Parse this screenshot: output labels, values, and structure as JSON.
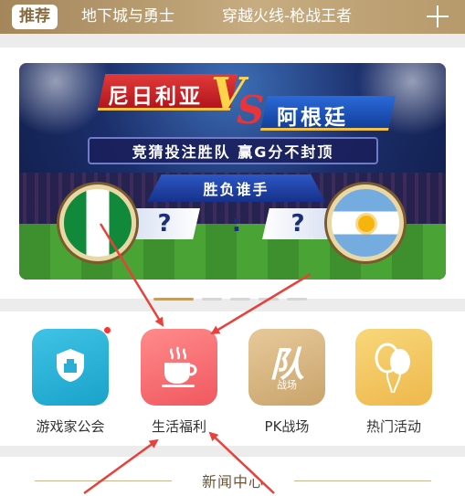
{
  "tabs": [
    {
      "label": "推荐",
      "active": true
    },
    {
      "label": "地下城与勇士",
      "active": false
    },
    {
      "label": "穿越火线-枪战王者",
      "active": false
    }
  ],
  "top_bar": {
    "add_icon": "plus-icon",
    "color": "#b79a6c"
  },
  "banner": {
    "team_left": "尼日利亚",
    "vs_v": "V",
    "vs_s": "S",
    "team_right": "阿根廷",
    "slogan": "竞猜投注胜队  赢G分不封顶",
    "question_title": "胜负谁手",
    "left_answer": "?",
    "separator": ":",
    "right_answer": "?",
    "flags": [
      "nigeria-flag",
      "argentina-flag"
    ],
    "carousel": {
      "pages": 5,
      "active": 1
    }
  },
  "apps": [
    {
      "label": "游戏家公会",
      "icon": "shield-icon",
      "color": "#29b3dc",
      "has_badge": true
    },
    {
      "label": "生活福利",
      "icon": "coffee-cup-icon",
      "color": "#f5676c",
      "has_badge": false
    },
    {
      "label": "PK战场",
      "icon": "pk-battle-icon",
      "glyph": "队",
      "sub": "战场",
      "color": "#d6b682",
      "has_badge": false
    },
    {
      "label": "热门活动",
      "icon": "balloons-icon",
      "color": "#f3c762",
      "has_badge": false
    }
  ],
  "news": {
    "title": "新闻中心"
  },
  "annotations": {
    "arrow_color": "#e8403a"
  }
}
